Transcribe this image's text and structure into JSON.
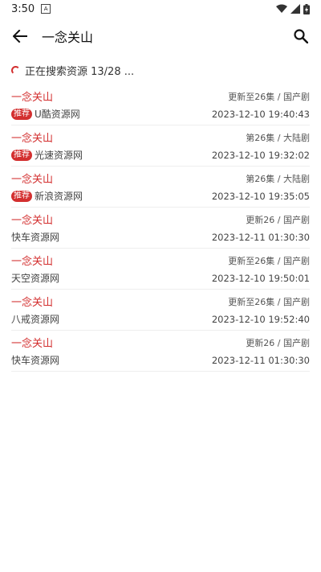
{
  "status_bar": {
    "time": "3:50",
    "a_badge": "A"
  },
  "app_bar": {
    "title": "一念关山"
  },
  "progress": {
    "text": "正在搜索资源 13/28 ..."
  },
  "results": [
    {
      "name": "一念关山",
      "meta": "更新至26集 / 国产剧",
      "badge": "推荐",
      "source": "U酷资源网",
      "time": "2023-12-10 19:40:43"
    },
    {
      "name": "一念关山",
      "meta": "第26集 / 大陆剧",
      "badge": "推荐",
      "source": "光速资源网",
      "time": "2023-12-10 19:32:02"
    },
    {
      "name": "一念关山",
      "meta": "第26集 / 大陆剧",
      "badge": "推荐",
      "source": "新浪资源网",
      "time": "2023-12-10 19:35:05"
    },
    {
      "name": "一念关山",
      "meta": "更新26 / 国产剧",
      "badge": "",
      "source": "快车资源网",
      "time": "2023-12-11 01:30:30"
    },
    {
      "name": "一念关山",
      "meta": "更新至26集 / 国产剧",
      "badge": "",
      "source": "天空资源网",
      "time": "2023-12-10 19:50:01"
    },
    {
      "name": "一念关山",
      "meta": "更新至26集 / 国产剧",
      "badge": "",
      "source": "八戒资源网",
      "time": "2023-12-10 19:52:40"
    },
    {
      "name": "一念关山",
      "meta": "更新26 / 国产剧",
      "badge": "",
      "source": "快车资源网",
      "time": "2023-12-11 01:30:30"
    }
  ],
  "icons": {
    "back": "arrow-left-icon",
    "search": "search-icon",
    "wifi": "wifi-icon",
    "signal": "signal-icon",
    "battery": "battery-icon"
  },
  "colors": {
    "accent": "#d32f2f"
  }
}
